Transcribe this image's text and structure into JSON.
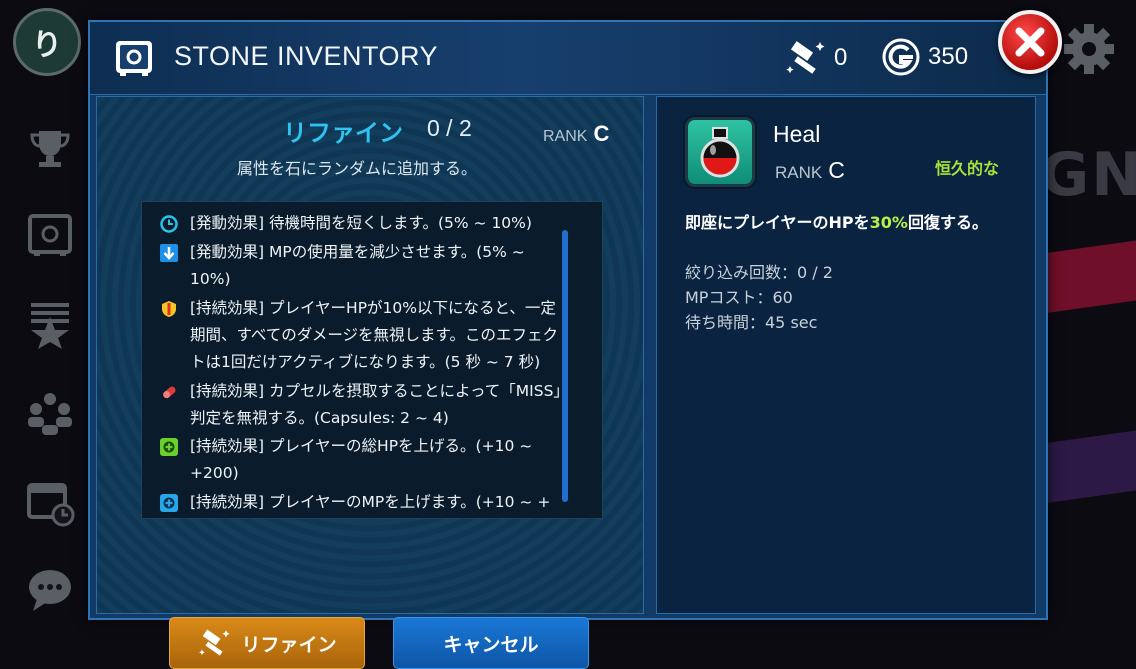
{
  "background": {
    "avatar_char": "り",
    "deco_text": "GN",
    "accent_colors": {
      "stripe_red": "#8a1030",
      "stripe_purple": "#3a1f5c"
    }
  },
  "side_rail": {
    "icons": [
      "trophy-icon",
      "safe-icon",
      "ranking-icon",
      "team-icon",
      "calendar-icon",
      "chat-icon"
    ]
  },
  "header": {
    "title": "STONE INVENTORY",
    "hammer_count": "0",
    "gold_amount": "350"
  },
  "refine": {
    "heading": "リファイン",
    "count": "0 / 2",
    "rank_label": "RANK",
    "rank_value": "C",
    "description": "属性を石にランダムに追加する。"
  },
  "effects": [
    {
      "icon": "clock-icon",
      "color": "#27c3e8",
      "text": "[発動効果] 待機時間を短くします。(5% ~ 10%)"
    },
    {
      "icon": "down-arrow-icon",
      "color": "#1e90e8",
      "text": "[発動効果] MPの使用量を減少させます。(5% ~ 10%)"
    },
    {
      "icon": "shield-icon",
      "color": "#f2c428",
      "text": "[持続効果] プレイヤーHPが10%以下になると、一定期間、すべてのダメージを無視します。このエフェクトは1回だけアクティブになります。(5 秒 ~ 7 秒)"
    },
    {
      "icon": "capsule-icon",
      "color": "#e23a3a",
      "text": "[持続効果] カプセルを摂取することによって「MISS」判定を無視する。(Capsules: 2 ~ 4)"
    },
    {
      "icon": "plus-green-icon",
      "color": "#6ad12a",
      "text": "[持続効果] プレイヤーの総HPを上げる。(+10 ~ +200)"
    },
    {
      "icon": "plus-blue-icon",
      "color": "#27a7e8",
      "text": "[持続効果] プレイヤーのMPを上げます。(+10 ~ +"
    }
  ],
  "buttons": {
    "refine_label": "リファイン",
    "cancel_label": "キャンセル"
  },
  "stone": {
    "name": "Heal",
    "rank_label": "RANK",
    "rank_value": "C",
    "duration_type": "恒久的な",
    "desc_prefix": "即座にプレイヤーのHPを",
    "desc_highlight": "30%",
    "desc_suffix": "回復する。",
    "stats": [
      "絞り込み回数：0 / 2",
      "MPコスト：60",
      "待ち時間：45 sec"
    ]
  }
}
